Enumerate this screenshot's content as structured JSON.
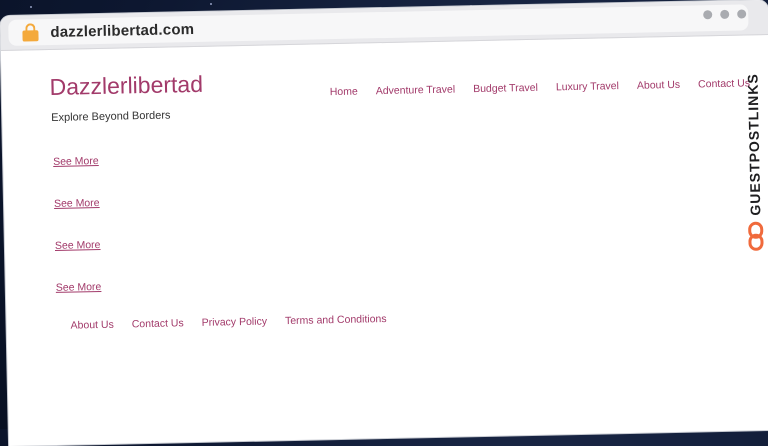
{
  "browser": {
    "url": "dazzlerlibertad.com"
  },
  "site": {
    "title": "Dazzlerlibertad",
    "tagline": "Explore Beyond Borders"
  },
  "nav": {
    "items": [
      "Home",
      "Adventure Travel",
      "Budget Travel",
      "Luxury Travel",
      "About Us",
      "Contact Us"
    ]
  },
  "content": {
    "see_more": [
      "See More",
      "See More",
      "See More",
      "See More"
    ]
  },
  "footer": {
    "links": [
      "About Us",
      "Contact Us",
      "Privacy Policy",
      "Terms and Conditions"
    ]
  },
  "watermark": {
    "text": "GUESTPOSTLINKS"
  },
  "colors": {
    "accent": "#a23a6a",
    "lock": "#f4a93b",
    "watermark_logo": "#f06a3c"
  }
}
